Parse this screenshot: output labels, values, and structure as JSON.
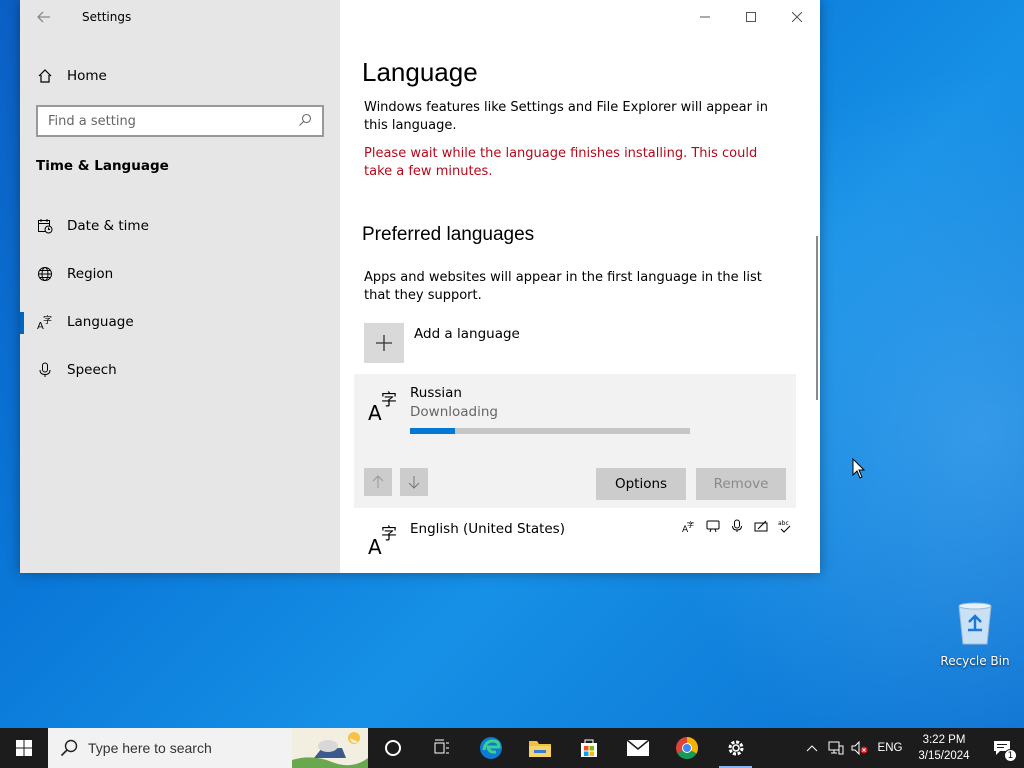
{
  "window": {
    "title": "Settings",
    "back_icon": "back-arrow-icon"
  },
  "sidebar": {
    "home_label": "Home",
    "search_placeholder": "Find a setting",
    "section_title": "Time & Language",
    "items": [
      {
        "label": "Date & time",
        "icon": "calendar-clock-icon"
      },
      {
        "label": "Region",
        "icon": "globe-icon"
      },
      {
        "label": "Language",
        "icon": "language-icon",
        "active": true
      },
      {
        "label": "Speech",
        "icon": "microphone-icon"
      }
    ]
  },
  "content": {
    "title": "Language",
    "description": "Windows features like Settings and File Explorer will appear in this language.",
    "warning": "Please wait while the language finishes installing. This could take a few minutes.",
    "preferred_title": "Preferred languages",
    "preferred_description": "Apps and websites will appear in the first language in the list that they support.",
    "add_language_label": "Add a language",
    "languages": [
      {
        "name": "Russian",
        "status": "Downloading",
        "progress_percent": 16
      },
      {
        "name": "English (United States)"
      }
    ],
    "options_label": "Options",
    "remove_label": "Remove"
  },
  "desktop": {
    "recycle_bin_label": "Recycle Bin"
  },
  "taskbar": {
    "search_placeholder": "Type here to search",
    "language_indicator": "ENG",
    "time": "3:22 PM",
    "date": "3/15/2024",
    "notification_count": "1"
  },
  "colors": {
    "accent": "#0078d4",
    "warning": "#b4091b",
    "sidebar_bg": "#e6e6e6",
    "taskbar_bg": "#1c1c1c"
  }
}
